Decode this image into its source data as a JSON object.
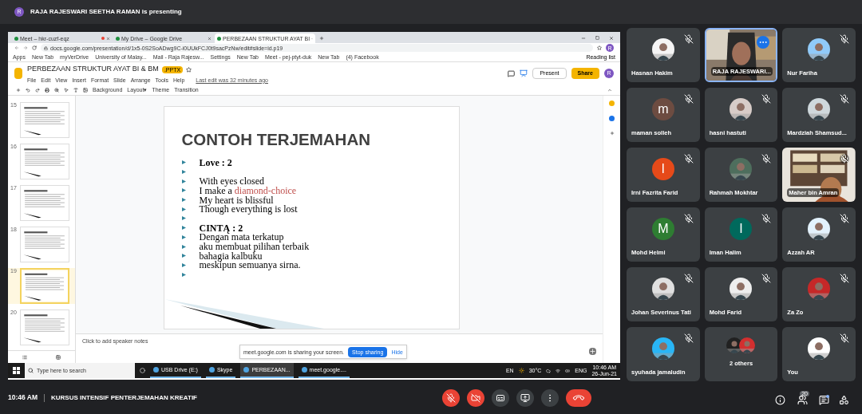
{
  "presenting_banner": {
    "avatar": "R",
    "text": "RAJA RAJESWARI SEETHA RAMAN is presenting"
  },
  "shared_screen": {
    "browser": {
      "tabs": [
        {
          "title": "Meet – hkr-cuzf-eqz",
          "recording": true,
          "selected": false
        },
        {
          "title": "My Drive – Google Drive",
          "recording": false,
          "selected": false
        },
        {
          "title": "PERBEZAAN STRUKTUR AYAT BI",
          "recording": false,
          "selected": true
        }
      ],
      "url": "docs.google.com/presentation/d/1x5-0S2SoADwg9C-i0UUkFCJ0t9sacPzNw/edit#slide=id.p19",
      "profile": "R",
      "bookmarks": [
        "Apps",
        "New Tab",
        "myVerDrive",
        "University of Malay...",
        "Mail - Raja Rajesw...",
        "Settings",
        "New Tab",
        "Meet - pej-ptyt-duk",
        "New Tab",
        "(4) Facebook"
      ],
      "reading_list": "Reading list"
    },
    "slides_app": {
      "title": "PERBEZAAN STRUKTUR AYAT BI & BM",
      "badge": ".PPTX",
      "menus": [
        "File",
        "Edit",
        "View",
        "Insert",
        "Format",
        "Slide",
        "Arrange",
        "Tools",
        "Help"
      ],
      "last_edit": "Last edit was 32 minutes ago",
      "present": "Present",
      "share": "Share",
      "avatar": "R",
      "toolbar": [
        "Background",
        "Layout▾",
        "Theme",
        "Transition"
      ]
    },
    "filmstrip": [
      {
        "number": "15",
        "selected": false
      },
      {
        "number": "16",
        "selected": false
      },
      {
        "number": "17",
        "selected": false
      },
      {
        "number": "18",
        "selected": false
      },
      {
        "number": "19",
        "selected": true
      },
      {
        "number": "20",
        "selected": false
      }
    ],
    "slide": {
      "title": "CONTOH TERJEMAHAN",
      "lines": [
        {
          "kind": "heading",
          "text": "Love : 2"
        },
        {
          "kind": "blank"
        },
        {
          "kind": "line",
          "text": "With eyes closed"
        },
        {
          "kind": "line",
          "text": "I make a ",
          "accent": "diamond-choice"
        },
        {
          "kind": "line",
          "text": "My heart is blissful"
        },
        {
          "kind": "line",
          "text": "Though everything is lost"
        },
        {
          "kind": "blank"
        },
        {
          "kind": "heading",
          "text": "CINTĄ : 2"
        },
        {
          "kind": "line",
          "text": "Dengan mata terkatup"
        },
        {
          "kind": "line",
          "text": "aku membuat pilihan terbaik"
        },
        {
          "kind": "line",
          "text": "bahagia kalbuku"
        },
        {
          "kind": "line",
          "text": "meskipun semuanya sirna."
        },
        {
          "kind": "blank"
        }
      ]
    },
    "speaker_notes": {
      "placeholder": "Click to add speaker notes"
    },
    "share_notice": {
      "text": "meet.google.com is sharing your screen.",
      "stop": "Stop sharing",
      "hide": "Hide"
    },
    "taskbar": {
      "search_placeholder": "Type here to search",
      "apps": [
        {
          "label": "USB Drive (E:)",
          "active": false
        },
        {
          "label": "Skype",
          "active": false
        },
        {
          "label": "PERBEZAAN...",
          "active": true
        },
        {
          "label": "meet.google....",
          "active": false
        }
      ],
      "language": "EN",
      "weather": "30°C",
      "input": "ENG",
      "time": "10:46 AM",
      "date": "26-Jun-21"
    }
  },
  "participants": [
    {
      "name": "Hasnan Hakim",
      "color": "#f5f5f5",
      "muted": true,
      "highlighted": false
    },
    {
      "name": "RAJA RAJESWARI...",
      "kind": "video",
      "muted": false,
      "highlighted": true
    },
    {
      "name": "Nur Fariha",
      "color": "#90caf9",
      "muted": true,
      "highlighted": false
    },
    {
      "name": "maman solleh",
      "kind": "initial",
      "initial": "m",
      "color": "#6d4c41",
      "muted": true,
      "highlighted": false
    },
    {
      "name": "hasni hastuti",
      "color": "#d7ccc8",
      "muted": true,
      "highlighted": false
    },
    {
      "name": "Mardziah Shamsud...",
      "color": "#cfd8dc",
      "muted": true,
      "highlighted": false
    },
    {
      "name": "Irni Fazrita Farid",
      "kind": "initial",
      "initial": "I",
      "color": "#e64a19",
      "muted": true,
      "highlighted": false
    },
    {
      "name": "Rahmah Mokhtar",
      "color": "#4e6e5d",
      "muted": true,
      "highlighted": false
    },
    {
      "name": "Maher bin Amran",
      "kind": "video",
      "muted": true,
      "highlighted": false
    },
    {
      "name": "Mohd Helmi",
      "kind": "initial",
      "initial": "M",
      "color": "#2e7d32",
      "muted": true,
      "highlighted": false
    },
    {
      "name": "Iman Halim",
      "kind": "initial",
      "initial": "I",
      "color": "#00695c",
      "muted": true,
      "highlighted": false
    },
    {
      "name": "Azzah AR",
      "color": "#e3f2fd",
      "muted": true,
      "highlighted": false
    },
    {
      "name": "Johan Severinus Tati",
      "color": "#e0e0e0",
      "muted": true,
      "highlighted": false
    },
    {
      "name": "Mohd Farid",
      "color": "#eeeeee",
      "muted": true,
      "highlighted": false
    },
    {
      "name": "Za Zo",
      "color": "#c62828",
      "muted": true,
      "highlighted": false
    },
    {
      "name": "syuhada jamaludin",
      "color": "#29b6f6",
      "muted": true,
      "highlighted": false
    },
    {
      "name": "2 others",
      "kind": "group",
      "muted": false,
      "highlighted": false
    },
    {
      "name": "You",
      "color": "#ffffff",
      "muted": true,
      "highlighted": false
    }
  ],
  "meeting_bar": {
    "time": "10:46 AM",
    "title": "KURSUS INTENSIF PENTERJEMAHAN KREATIF",
    "controls": [
      {
        "kind": "mic",
        "on": false
      },
      {
        "kind": "camera",
        "on": false
      },
      {
        "kind": "captions"
      },
      {
        "kind": "present"
      },
      {
        "kind": "more"
      },
      {
        "kind": "leave"
      }
    ],
    "people_count": "20",
    "chat_unread": true
  }
}
